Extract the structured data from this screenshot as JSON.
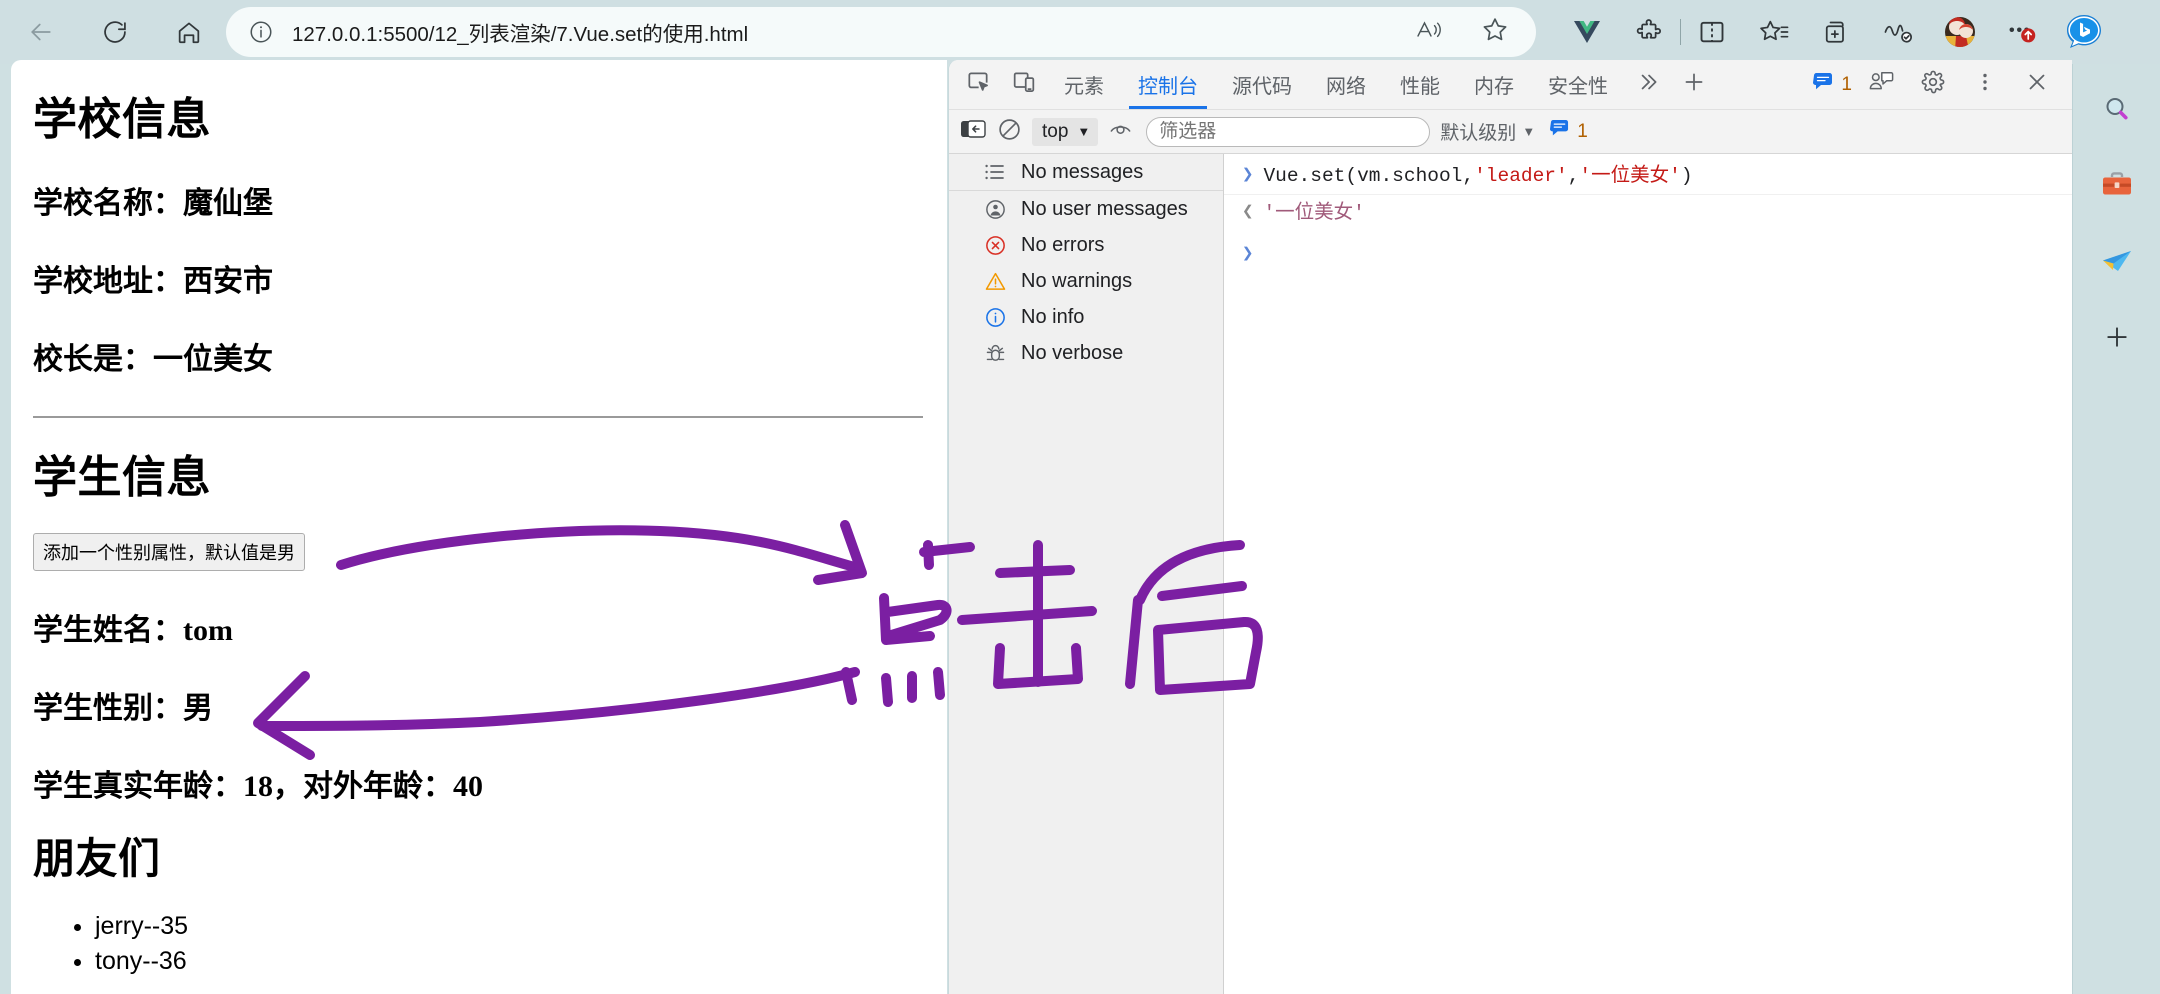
{
  "browser": {
    "nav": {
      "back_icon": "arrow-left-icon",
      "refresh_icon": "refresh-icon",
      "home_icon": "home-icon"
    },
    "address": {
      "info_icon": "info-circle-icon",
      "url": "127.0.0.1:5500/12_列表渲染/7.Vue.set的使用.html",
      "read_aloud_icon": "read-aloud-icon",
      "favorite_icon": "star-icon"
    },
    "extensions": [
      {
        "name": "vue-devtools-extension-icon",
        "label": "V"
      },
      {
        "name": "extensions-puzzle-icon",
        "label": ""
      },
      {
        "name": "split-screen-icon",
        "label": ""
      },
      {
        "name": "collections-icon",
        "label": ""
      },
      {
        "name": "add-to-collection-icon",
        "label": ""
      },
      {
        "name": "browser-essentials-icon",
        "label": ""
      },
      {
        "name": "profile-avatar",
        "label": ""
      },
      {
        "name": "settings-more-icon",
        "label": ""
      },
      {
        "name": "bing-copilot-icon",
        "label": ""
      }
    ],
    "sidebar": [
      {
        "name": "search-icon"
      },
      {
        "name": "tools-briefcase-icon"
      },
      {
        "name": "drop-paperplane-icon"
      },
      {
        "name": "add-sidebar-icon"
      }
    ]
  },
  "page": {
    "school_heading": "学校信息",
    "school_name_line": "学校名称：魔仙堡",
    "school_address_line": "学校地址：西安市",
    "school_leader_line": "校长是：一位美女",
    "student_heading": "学生信息",
    "add_gender_button": "添加一个性别属性，默认值是男",
    "student_name_line": "学生姓名：tom",
    "student_gender_line": "学生性别：男",
    "student_age_line": "学生真实年龄：18，对外年龄：40",
    "friends_heading": "朋友们",
    "friends": [
      "jerry--35",
      "tony--36"
    ]
  },
  "devtools": {
    "inspect_icon": "inspect-element-icon",
    "device_icon": "device-toolbar-icon",
    "tabs": [
      {
        "label": "元素",
        "active": false
      },
      {
        "label": "控制台",
        "active": true
      },
      {
        "label": "源代码",
        "active": false
      },
      {
        "label": "网络",
        "active": false
      },
      {
        "label": "性能",
        "active": false
      },
      {
        "label": "内存",
        "active": false
      },
      {
        "label": "安全性",
        "active": false
      }
    ],
    "more_tabs_icon": "chevron-double-right-icon",
    "add_tab_icon": "plus-icon",
    "message_count": "1",
    "feedback_icon": "feedback-person-icon",
    "settings_icon": "gear-icon",
    "more_icon": "more-vertical-icon",
    "close_icon": "close-icon",
    "console_toolbar": {
      "sidebar_toggle_icon": "console-sidebar-toggle-icon",
      "clear_icon": "clear-console-icon",
      "context": "top",
      "context_caret": "▼",
      "eye_icon": "live-expression-eye-icon",
      "filter_placeholder": "筛选器",
      "level": "默认级别",
      "level_caret": "▼",
      "badge_count": "1"
    },
    "console_sidebar": [
      {
        "icon": "list-icon",
        "label": "No messages"
      },
      {
        "icon": "user-icon",
        "label": "No user messages"
      },
      {
        "icon": "error-icon",
        "label": "No errors"
      },
      {
        "icon": "warning-icon",
        "label": "No warnings"
      },
      {
        "icon": "info-icon",
        "label": "No info"
      },
      {
        "icon": "bug-icon",
        "label": "No verbose"
      }
    ],
    "console_log": {
      "input_caret": "❯",
      "input_code_1": "Vue.set(vm.school,",
      "input_code_str1": "'leader'",
      "input_code_2": ",",
      "input_code_str2": "'一位美女'",
      "input_code_3": ")",
      "output_caret": "❮",
      "output_value": "'一位美女'",
      "prompt_caret": "❯"
    }
  },
  "annotations": {
    "ink_color": "#7b1fa2",
    "handwritten_text": "点击后",
    "arrow_top_name": "annotation-arrow-to-note",
    "arrow_bottom_name": "annotation-arrow-to-gender"
  }
}
